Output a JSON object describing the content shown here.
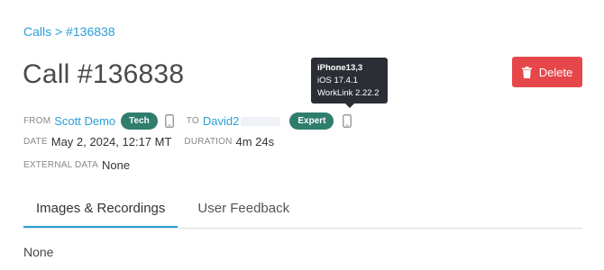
{
  "breadcrumb": {
    "parent": "Calls",
    "separator": ">",
    "current": "#136838"
  },
  "page": {
    "title": "Call #136838"
  },
  "actions": {
    "delete_label": "Delete",
    "delete_color": "#e5474b"
  },
  "call": {
    "from_label": "FROM",
    "from_name": "Scott Demo",
    "from_badge": "Tech",
    "to_label": "TO",
    "to_name": "David2",
    "to_badge": "Expert",
    "date_label": "DATE",
    "date_value": "May 2, 2024, 12:17 MT",
    "duration_label": "DURATION",
    "duration_value": "4m 24s",
    "external_label": "EXTERNAL DATA",
    "external_value": "None"
  },
  "tooltip": {
    "device": "iPhone13,3",
    "os": "iOS 17.4.1",
    "app": "WorkLink 2.22.2"
  },
  "tabs": [
    {
      "label": "Images & Recordings",
      "active": true
    },
    {
      "label": "User Feedback",
      "active": false
    }
  ],
  "tab_content": {
    "text": "None"
  },
  "colors": {
    "accent": "#2a9fd6",
    "badge": "#2f7d6d",
    "tooltip_bg": "#2b2f35"
  },
  "icons": [
    "trash-icon",
    "phone-icon"
  ]
}
